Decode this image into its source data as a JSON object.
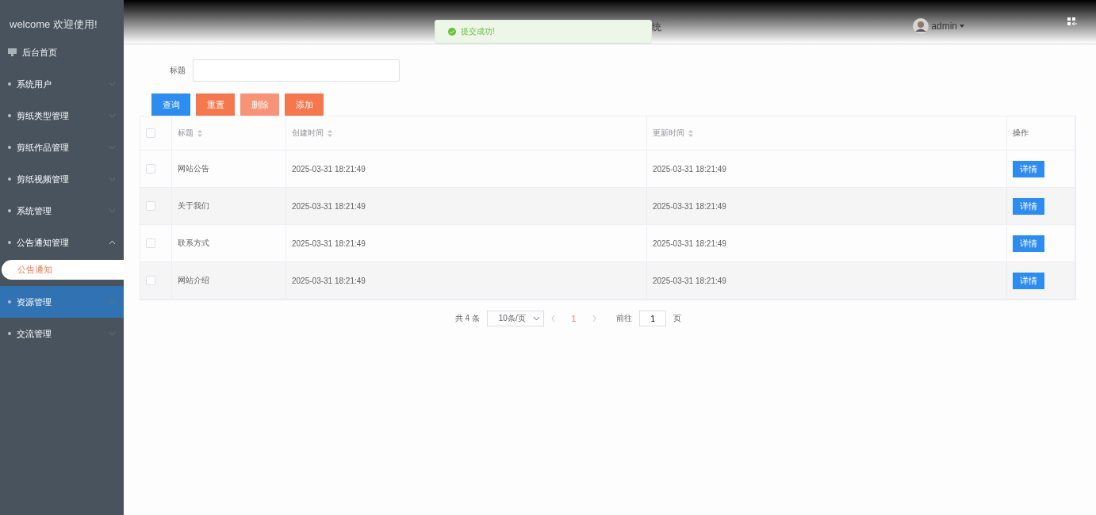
{
  "sidebar": {
    "welcome": "welcome 欢迎使用!",
    "items": [
      {
        "label": "后台首页",
        "kind": "home",
        "highlighted": false
      },
      {
        "label": "系统用户",
        "kind": "group",
        "expanded": false,
        "highlighted": false
      },
      {
        "label": "剪纸类型管理",
        "kind": "group",
        "expanded": false,
        "highlighted": false
      },
      {
        "label": "剪纸作品管理",
        "kind": "group",
        "expanded": false,
        "highlighted": false
      },
      {
        "label": "剪纸视频管理",
        "kind": "group",
        "expanded": false,
        "highlighted": false
      },
      {
        "label": "系统管理",
        "kind": "group",
        "expanded": false,
        "highlighted": false
      },
      {
        "label": "公告通知管理",
        "kind": "group",
        "expanded": true,
        "highlighted": false,
        "children": [
          {
            "label": "公告通知",
            "selected": true
          }
        ]
      },
      {
        "label": "资源管理",
        "kind": "group",
        "expanded": false,
        "highlighted": true
      },
      {
        "label": "交流管理",
        "kind": "group",
        "expanded": false,
        "highlighted": false
      }
    ]
  },
  "header": {
    "title": "统",
    "user": "admin"
  },
  "toast": {
    "message": "提交成功!"
  },
  "search": {
    "label": "标题"
  },
  "buttons": [
    {
      "label": "查询",
      "kind": "primary"
    },
    {
      "label": "重置",
      "kind": "danger"
    },
    {
      "label": "删除",
      "kind": "muted"
    },
    {
      "label": "添加",
      "kind": "danger"
    }
  ],
  "table": {
    "select_all": {
      "checked": false
    },
    "columns": [
      {
        "label": "标题",
        "sortable": true
      },
      {
        "label": "创建时间",
        "sortable": true
      },
      {
        "label": "更新时间",
        "sortable": true
      },
      {
        "label": "操作",
        "sortable": false
      }
    ],
    "rows": [
      {
        "checked": false,
        "cells": [
          "网站公告",
          "2025-03-31 18:21:49",
          "2025-03-31 18:21:49"
        ],
        "action": "详情"
      },
      {
        "checked": false,
        "cells": [
          "关于我们",
          "2025-03-31 18:21:49",
          "2025-03-31 18:21:49"
        ],
        "action": "详情"
      },
      {
        "checked": false,
        "cells": [
          "联系方式",
          "2025-03-31 18:21:49",
          "2025-03-31 18:21:49"
        ],
        "action": "详情"
      },
      {
        "checked": false,
        "cells": [
          "网站介绍",
          "2025-03-31 18:21:49",
          "2025-03-31 18:21:49"
        ],
        "action": "详情"
      }
    ]
  },
  "pagination": {
    "total": "共 4 条",
    "page_size": "10条/页",
    "pages": [
      {
        "label": "1",
        "selected": true
      }
    ],
    "goto_label": "前往",
    "goto_value": "1",
    "goto_suffix": "页"
  }
}
